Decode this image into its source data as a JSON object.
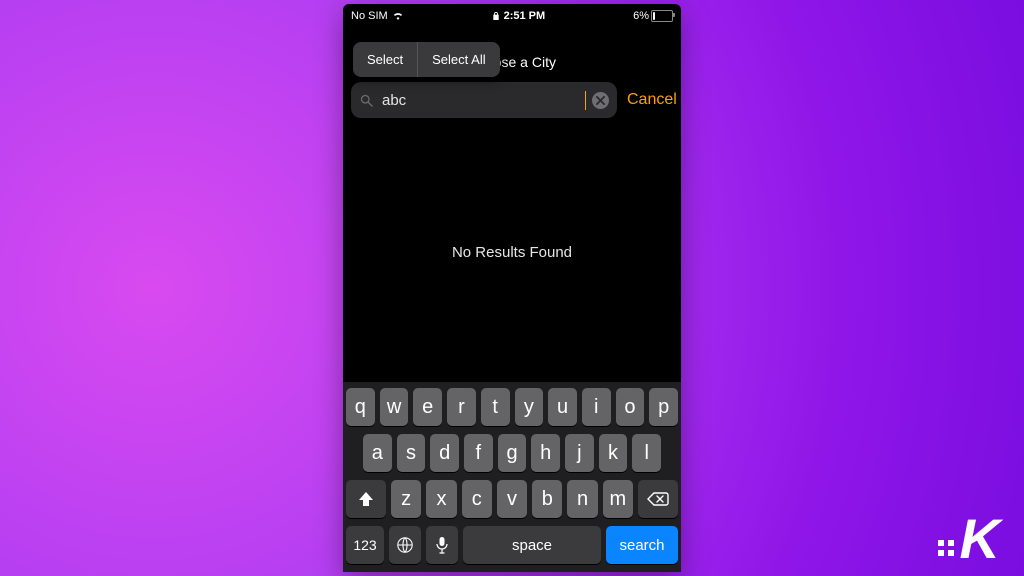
{
  "status": {
    "carrier": "No SIM",
    "time": "2:51 PM",
    "battery": "6%"
  },
  "popover": {
    "select": "Select",
    "selectAll": "Select All"
  },
  "nav": {
    "title": "Choose a City"
  },
  "search": {
    "value": "abc",
    "cancel": "Cancel"
  },
  "results": {
    "empty": "No Results Found"
  },
  "keyboard": {
    "row1": [
      "q",
      "w",
      "e",
      "r",
      "t",
      "y",
      "u",
      "i",
      "o",
      "p"
    ],
    "row2": [
      "a",
      "s",
      "d",
      "f",
      "g",
      "h",
      "j",
      "k",
      "l"
    ],
    "row3": [
      "z",
      "x",
      "c",
      "v",
      "b",
      "n",
      "m"
    ],
    "num": "123",
    "space": "space",
    "search": "search"
  },
  "watermark": "K"
}
